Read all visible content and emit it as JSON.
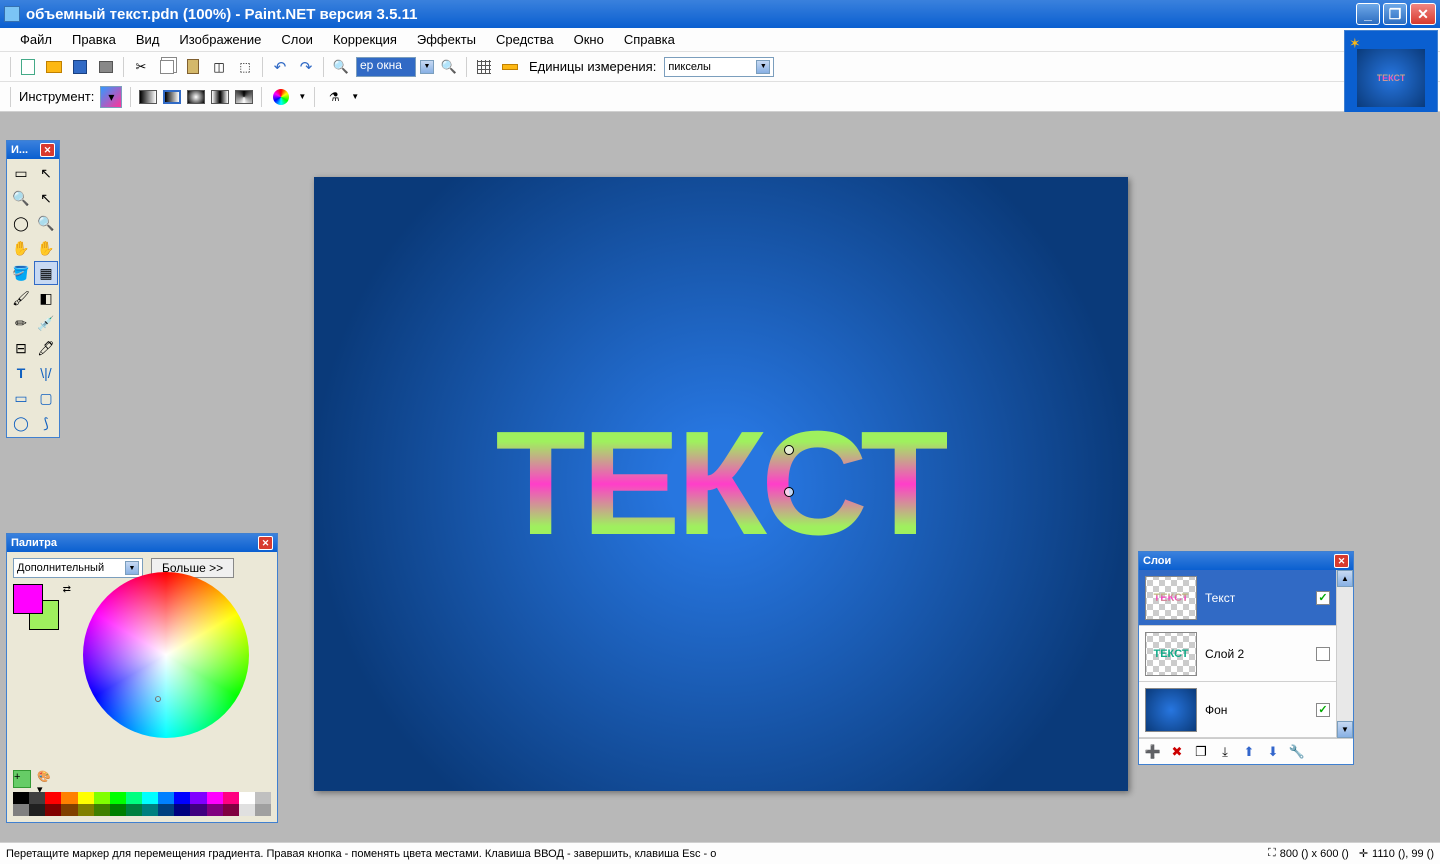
{
  "titlebar": {
    "text": "объемный текст.pdn (100%) - Paint.NET версия 3.5.11"
  },
  "menu": {
    "file": "Файл",
    "edit": "Правка",
    "view": "Вид",
    "image": "Изображение",
    "layers": "Слои",
    "adjust": "Коррекция",
    "effects": "Эффекты",
    "tools_m": "Средства",
    "window": "Окно",
    "help": "Справка"
  },
  "toolbar": {
    "zoom_value": "ер окна",
    "units_label": "Единицы измерения:",
    "units_value": "пикселы",
    "tool_label": "Инструмент:"
  },
  "canvas": {
    "text": "ТЕКСТ"
  },
  "tools": {
    "title": "И..."
  },
  "palette": {
    "title": "Палитра",
    "mode": "Дополнительный",
    "more": "Больше >>"
  },
  "layers": {
    "title": "Слои",
    "items": [
      {
        "name": "Текст",
        "checked": true,
        "selected": true
      },
      {
        "name": "Слой 2",
        "checked": false,
        "selected": false
      },
      {
        "name": "Фон",
        "checked": true,
        "selected": false
      }
    ]
  },
  "status": {
    "hint": "Перетащите маркер для перемещения градиента. Правая кнопка - поменять цвета местами. Клавиша ВВОД - завершить, клавиша Esc - о",
    "size": "800 () x 600 ()",
    "pos": "1110 (), 99 ()"
  },
  "thumb": {
    "text": "ТЕКСТ"
  }
}
